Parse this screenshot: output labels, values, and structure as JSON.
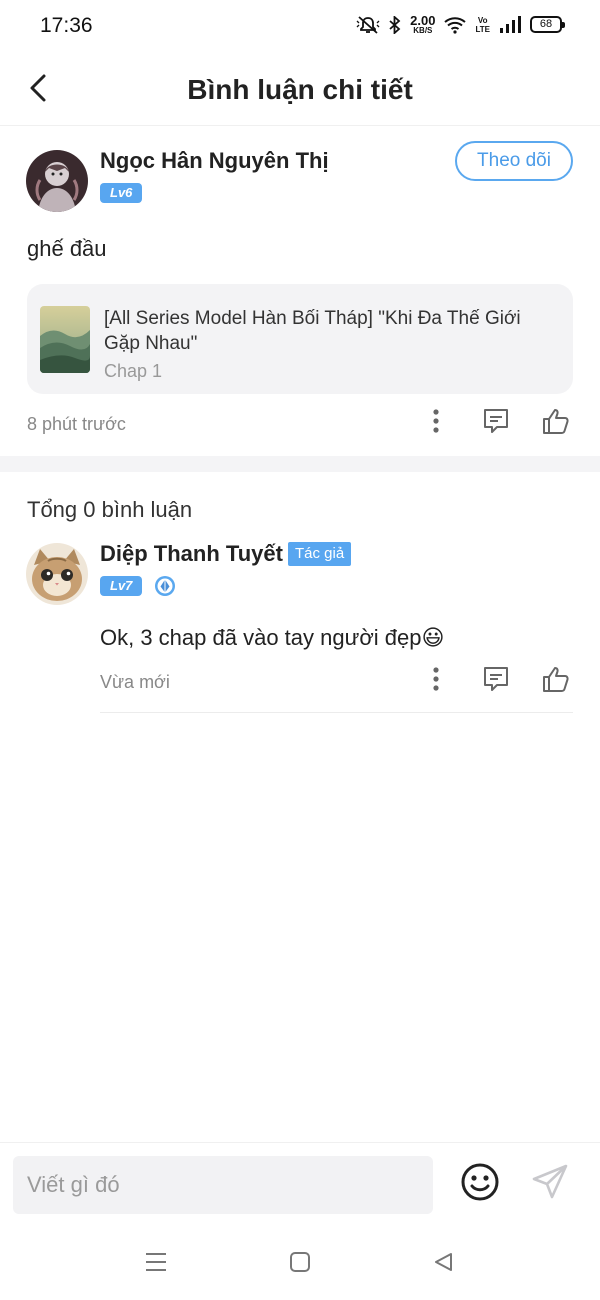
{
  "status_bar": {
    "time": "17:36",
    "net_speed_value": "2.00",
    "net_speed_unit": "KB/S",
    "volte_top": "Vo",
    "volte_bottom": "LTE",
    "battery": "68",
    "icons": [
      "mute-icon",
      "bluetooth-icon",
      "wifi-icon",
      "signal-icon",
      "battery-icon"
    ]
  },
  "header": {
    "title": "Bình luận chi tiết",
    "back_icon": "chevron-left-icon"
  },
  "main_comment": {
    "username": "Ngọc Hân Nguyên Thị",
    "level": "Lv6",
    "follow_label": "Theo dõi",
    "text": "ghế đầu",
    "series": {
      "title": "[All Series Model Hàn Bối Tháp] \"Khi Đa Thế Giới Gặp Nhau\"",
      "chapter": "Chap 1"
    },
    "time": "8 phút trước",
    "actions": [
      "more-icon",
      "comment-icon",
      "like-icon"
    ]
  },
  "replies": {
    "total_label": "Tổng 0 bình luận",
    "items": [
      {
        "username": "Diệp Thanh Tuyết",
        "author_tag": "Tác giả",
        "level": "Lv7",
        "text": "Ok, 3 chap đã vào tay người đẹp😃",
        "time": "Vừa mới"
      }
    ]
  },
  "input": {
    "placeholder": "Viết gì đó"
  },
  "colors": {
    "accent": "#58a6f0",
    "follow_text": "#4a9be8",
    "card_bg": "#f3f3f5",
    "muted_text": "#888888"
  }
}
